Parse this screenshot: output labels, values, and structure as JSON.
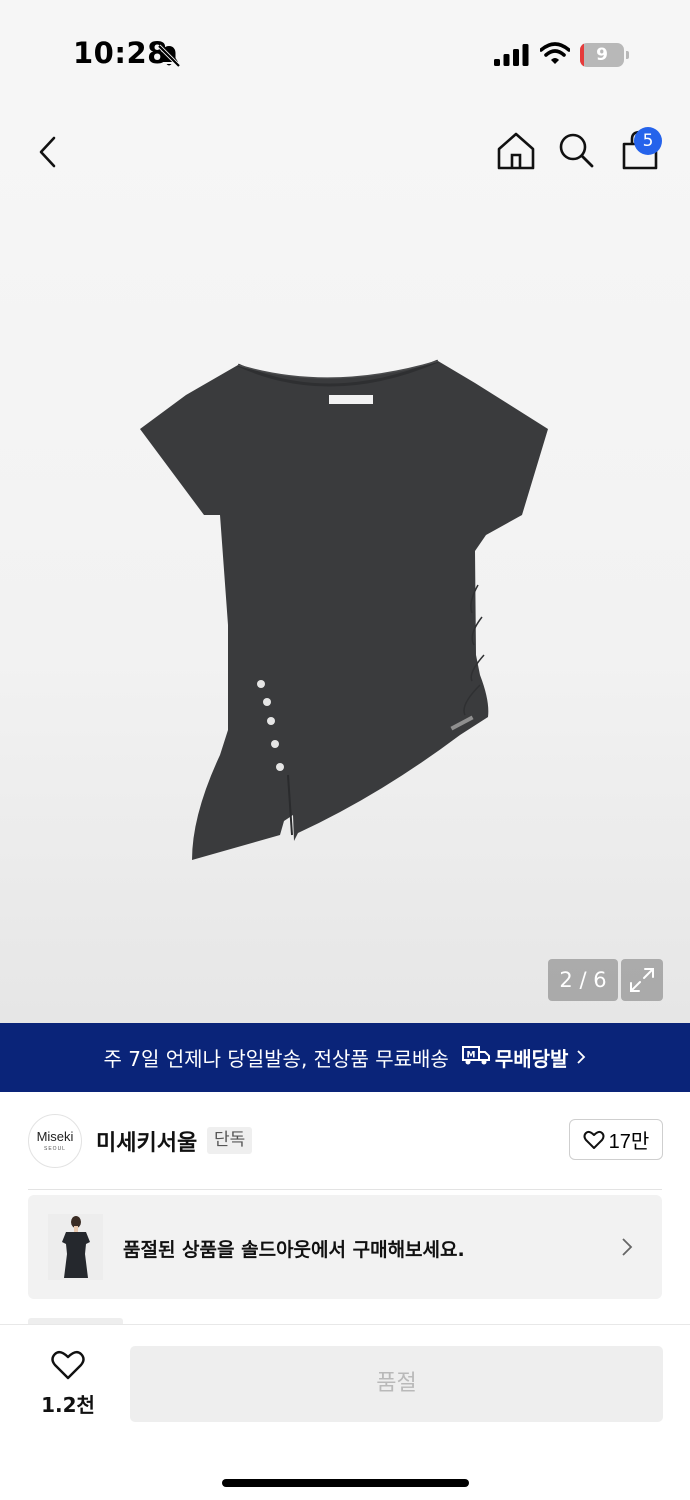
{
  "status_bar": {
    "time": "10:28",
    "battery_level": "9",
    "icons": [
      "bell-slash-icon",
      "signal-icon",
      "wifi-icon",
      "battery-icon"
    ]
  },
  "nav": {
    "icons": [
      "back-icon",
      "home-icon",
      "search-icon",
      "shopping-bag-icon"
    ],
    "cart_count": "5"
  },
  "gallery": {
    "pager": "2 / 6",
    "current_image": 2,
    "total_images": 6,
    "icons": [
      "expand-icon"
    ]
  },
  "promo": {
    "text": "주 7일 언제나 당일발송, 전상품 무료배송",
    "badge": "무배당발",
    "icons": [
      "delivery-truck-icon",
      "chevron-right-icon"
    ]
  },
  "brand": {
    "logo_text": "Miseki",
    "logo_subtext": "SEOUL",
    "name": "미세키서울",
    "tag": "단독",
    "likes": "17만"
  },
  "soldout_card": {
    "text": "품절된 상품을 솔드아웃에서 구매해보세요.",
    "icons": [
      "chevron-right-icon"
    ]
  },
  "bottom_bar": {
    "wish_count": "1.2천",
    "buy_label": "품절"
  },
  "colors": {
    "promo_bg": "#0a2479",
    "badge_blue": "#2563eb",
    "product_gray": "#3a3b3d"
  }
}
